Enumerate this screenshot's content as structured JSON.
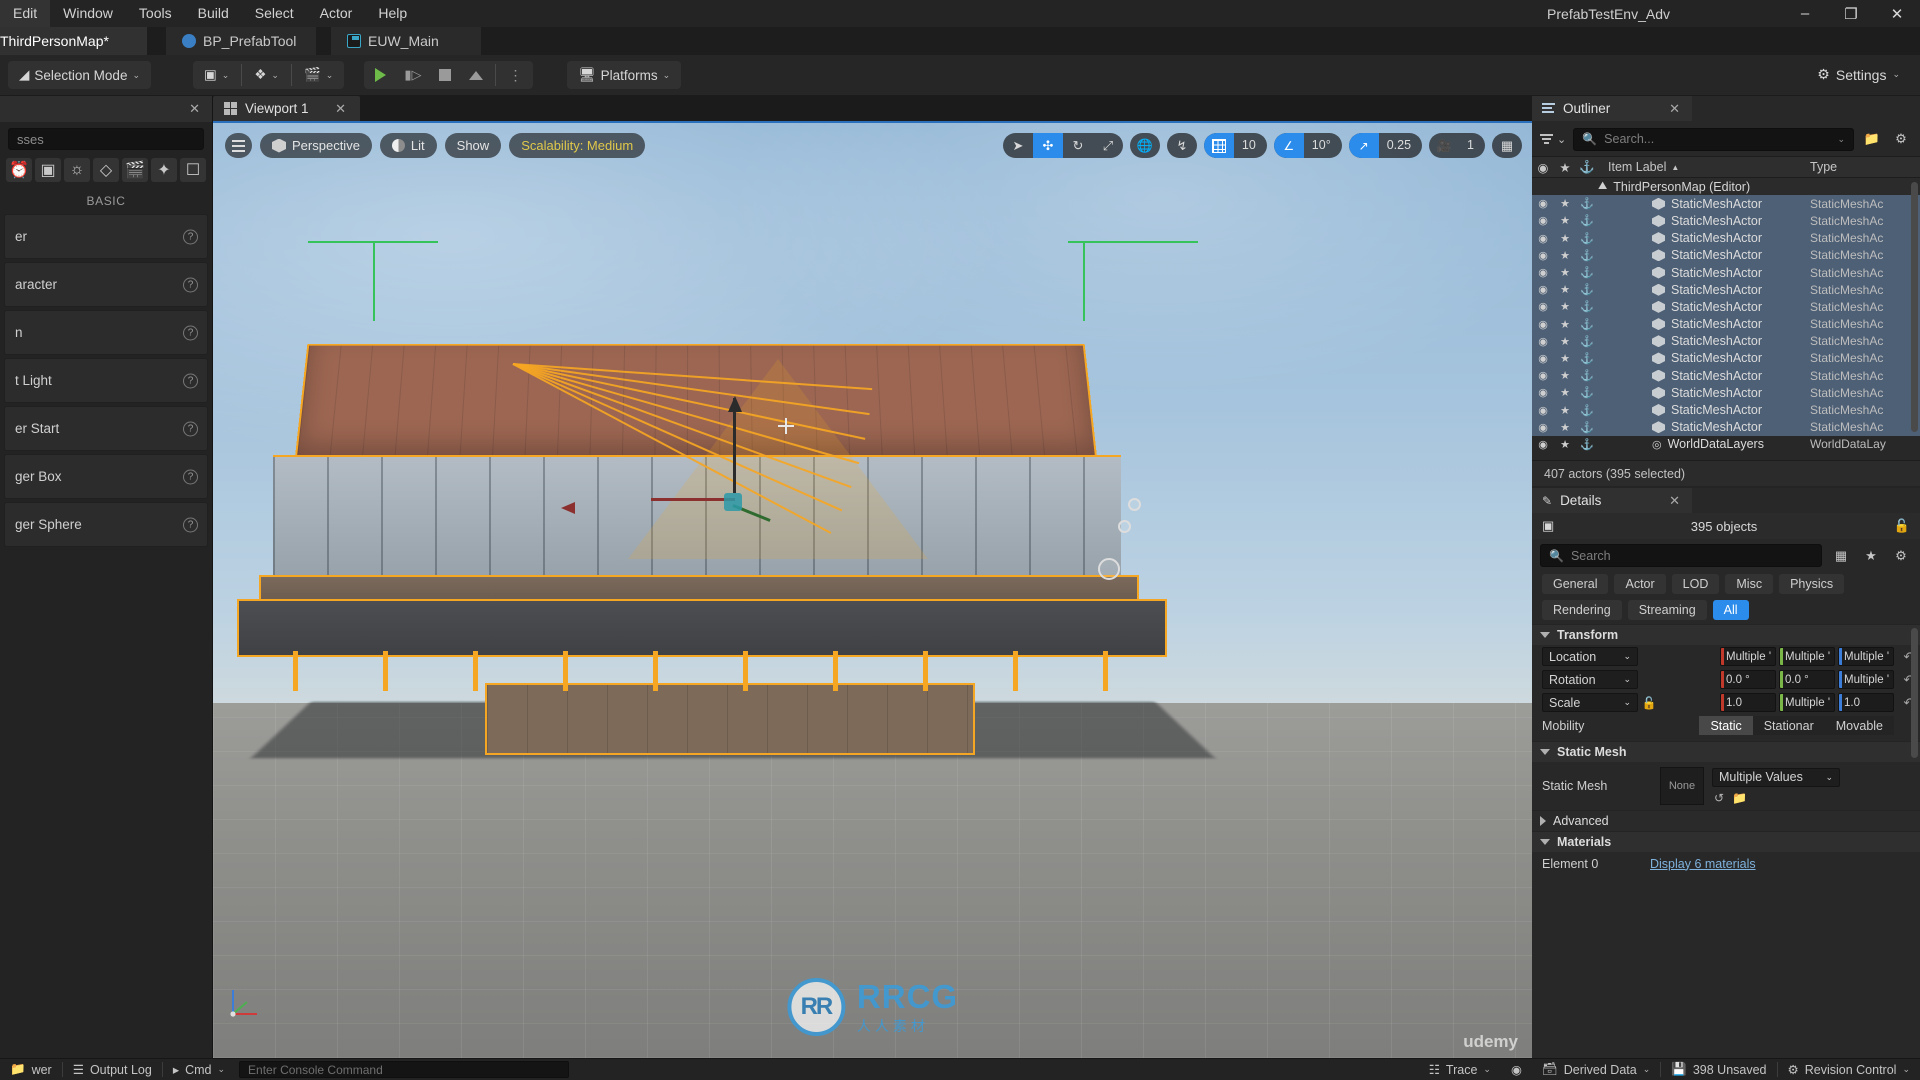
{
  "menu": {
    "items": [
      "Edit",
      "Window",
      "Tools",
      "Build",
      "Select",
      "Actor",
      "Help"
    ],
    "window_title": "PrefabTestEnv_Adv",
    "minimize": "–",
    "maximize": "❐",
    "close": "✕"
  },
  "asset_tabs": [
    {
      "label": "ThirdPersonMap*",
      "icon": "map-icon",
      "active": true
    },
    {
      "label": "BP_PrefabTool",
      "icon": "blueprint-icon",
      "active": false
    },
    {
      "label": "EUW_Main",
      "icon": "editor-widget-icon",
      "active": false
    }
  ],
  "toolbar": {
    "selection_mode": "Selection Mode",
    "caret": "⌄",
    "platforms": "Platforms",
    "settings": "Settings",
    "quick_add_icon": "add-actor-icon",
    "blueprints_icon": "blueprints-icon",
    "cinematics_icon": "cinematics-icon",
    "play_icon": "play-icon",
    "step_icon": "step-icon",
    "stop_icon": "stop-icon",
    "eject_icon": "eject-icon",
    "more_icon": "more-options-icon"
  },
  "place_actors": {
    "tab_close": "✕",
    "search_placeholder": "sses",
    "section": "BASIC",
    "tool_icons": [
      "recently-placed-icon",
      "basic-icon",
      "lights-icon",
      "shapes-icon",
      "cinematic-icon",
      "visual-effects-icon",
      "volumes-icon"
    ],
    "items": [
      {
        "label": "er",
        "help": "?"
      },
      {
        "label": "aracter",
        "help": "?"
      },
      {
        "label": "n",
        "help": "?"
      },
      {
        "label": "t Light",
        "help": "?"
      },
      {
        "label": "er Start",
        "help": "?"
      },
      {
        "label": "ger Box",
        "help": "?"
      },
      {
        "label": "ger Sphere",
        "help": "?"
      }
    ]
  },
  "viewport": {
    "tab_label": "Viewport 1",
    "tab_close": "✕",
    "menu_icon": "viewport-menu-icon",
    "camera_mode": "Perspective",
    "view_mode": "Lit",
    "show_menu": "Show",
    "scalability": "Scalability: Medium",
    "gizmo_buttons": [
      {
        "name": "select-tool",
        "glyph": "➤",
        "active": false
      },
      {
        "name": "translate-tool",
        "glyph": "✥",
        "active": true
      },
      {
        "name": "rotate-tool",
        "glyph": "⟳",
        "active": false
      },
      {
        "name": "scale-tool",
        "glyph": "⤢",
        "active": false
      }
    ],
    "world_coord_icon": "globe-icon",
    "surface_snap_icon": "surface-snapping-icon",
    "grid_snap_value": "10",
    "angle_snap_value": "10°",
    "scale_snap_value": "0.25",
    "camera_speed_value": "1",
    "layouts_icon": "viewport-layouts-icon",
    "watermark_big": "RRCG",
    "watermark_small": "人人素材",
    "watermark_logo": "RR",
    "udemy": "udemy"
  },
  "outliner": {
    "tab_label": "Outliner",
    "tab_close": "✕",
    "search_placeholder": "Search...",
    "filter_icon": "filter-icon",
    "add_folder_icon": "new-folder-icon",
    "settings_icon": "settings-gear-icon",
    "columns": {
      "visibility": "◉",
      "pinned": "★",
      "lock": "⚓",
      "item_label": "Item Label",
      "sort_arrow": "▲",
      "type": "Type"
    },
    "root": {
      "label": "ThirdPersonMap (Editor)",
      "type": ""
    },
    "rows": [
      {
        "label": "StaticMeshActor",
        "type": "StaticMeshAc",
        "selected": true
      },
      {
        "label": "StaticMeshActor",
        "type": "StaticMeshAc",
        "selected": true
      },
      {
        "label": "StaticMeshActor",
        "type": "StaticMeshAc",
        "selected": true
      },
      {
        "label": "StaticMeshActor",
        "type": "StaticMeshAc",
        "selected": true
      },
      {
        "label": "StaticMeshActor",
        "type": "StaticMeshAc",
        "selected": true
      },
      {
        "label": "StaticMeshActor",
        "type": "StaticMeshAc",
        "selected": true
      },
      {
        "label": "StaticMeshActor",
        "type": "StaticMeshAc",
        "selected": true
      },
      {
        "label": "StaticMeshActor",
        "type": "StaticMeshAc",
        "selected": true
      },
      {
        "label": "StaticMeshActor",
        "type": "StaticMeshAc",
        "selected": true
      },
      {
        "label": "StaticMeshActor",
        "type": "StaticMeshAc",
        "selected": true
      },
      {
        "label": "StaticMeshActor",
        "type": "StaticMeshAc",
        "selected": true
      },
      {
        "label": "StaticMeshActor",
        "type": "StaticMeshAc",
        "selected": true
      },
      {
        "label": "StaticMeshActor",
        "type": "StaticMeshAc",
        "selected": true
      },
      {
        "label": "StaticMeshActor",
        "type": "StaticMeshAc",
        "selected": true
      }
    ],
    "world_row": {
      "label": "WorldDataLayers",
      "type": "WorldDataLay"
    },
    "footer": "407 actors (395 selected)"
  },
  "details": {
    "tab_label": "Details",
    "tab_close": "✕",
    "object_count": "395 objects",
    "lock_icon": "unlock-icon",
    "search_placeholder": "Search",
    "column_icon": "column-layout-icon",
    "favorite_icon": "favorite-star-icon",
    "settings_icon": "settings-gear-icon",
    "categories_row1": [
      "General",
      "Actor",
      "LOD",
      "Misc",
      "Physics"
    ],
    "categories_row2": [
      "Rendering",
      "Streaming",
      "All"
    ],
    "active_category": "All",
    "transform": {
      "title": "Transform",
      "location": {
        "label": "Location",
        "x": "Multiple '",
        "y": "Multiple '",
        "z": "Multiple '"
      },
      "rotation": {
        "label": "Rotation",
        "x": "0.0 °",
        "y": "0.0 °",
        "z": "Multiple '"
      },
      "scale": {
        "label": "Scale",
        "x": "1.0",
        "y": "Multiple '",
        "z": "1.0"
      },
      "mobility": {
        "label": "Mobility",
        "options": [
          "Static",
          "Stationar",
          "Movable"
        ],
        "active": "Static"
      },
      "reset_icon": "reset-arrow-icon",
      "lock_icon": "lock-ratio-icon"
    },
    "static_mesh": {
      "title": "Static Mesh",
      "label": "Static Mesh",
      "thumb": "None",
      "value": "Multiple Values",
      "browse_icon": "browse-to-asset-icon",
      "use_selected_icon": "use-selected-asset-icon"
    },
    "advanced": "Advanced",
    "materials": {
      "title": "Materials",
      "element_label": "Element 0",
      "link": "Display 6 materials"
    }
  },
  "status_bar": {
    "output_log": "Output Log",
    "cmd": "Cmd",
    "console_placeholder": "Enter Console Command",
    "left_panel_label": "wer",
    "trace": "Trace",
    "derived_data": "Derived Data",
    "unsaved": "398 Unsaved",
    "revision_control": "Revision Control",
    "network_icon": "network-icon",
    "content_icon": "content-drawer-icon"
  }
}
